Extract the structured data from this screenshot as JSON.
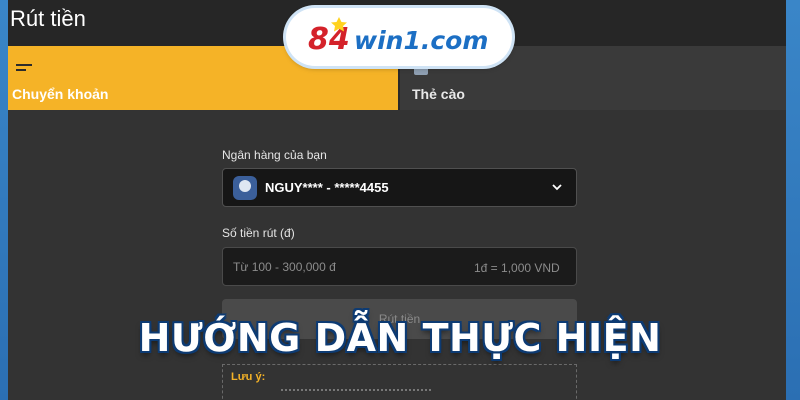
{
  "window": {
    "title": "Rút tiền"
  },
  "logo": {
    "text_number": "84",
    "text_brand": "win1.com"
  },
  "tabs": [
    {
      "label": "Chuyển khoản",
      "icon": "list-icon",
      "active": true
    },
    {
      "label": "Thẻ cào",
      "icon": "card-icon",
      "active": false
    }
  ],
  "bank": {
    "label": "Ngân hàng của bạn",
    "value": "NGUY**** - *****4455"
  },
  "amount": {
    "label": "Số tiền rút (đ)",
    "placeholder": "Từ 100 - 300,000 đ",
    "rate": "1đ = 1,000 VND"
  },
  "submit": {
    "label": "Rút tiền"
  },
  "note": {
    "label": "Lưu ý:"
  },
  "banner": {
    "text": "HƯỚNG DẪN THỰC HIỆN"
  },
  "colors": {
    "accent": "#f5b327",
    "background": "#333333",
    "frame": "#3a86c8",
    "banner_outline": "#0d3b73"
  }
}
